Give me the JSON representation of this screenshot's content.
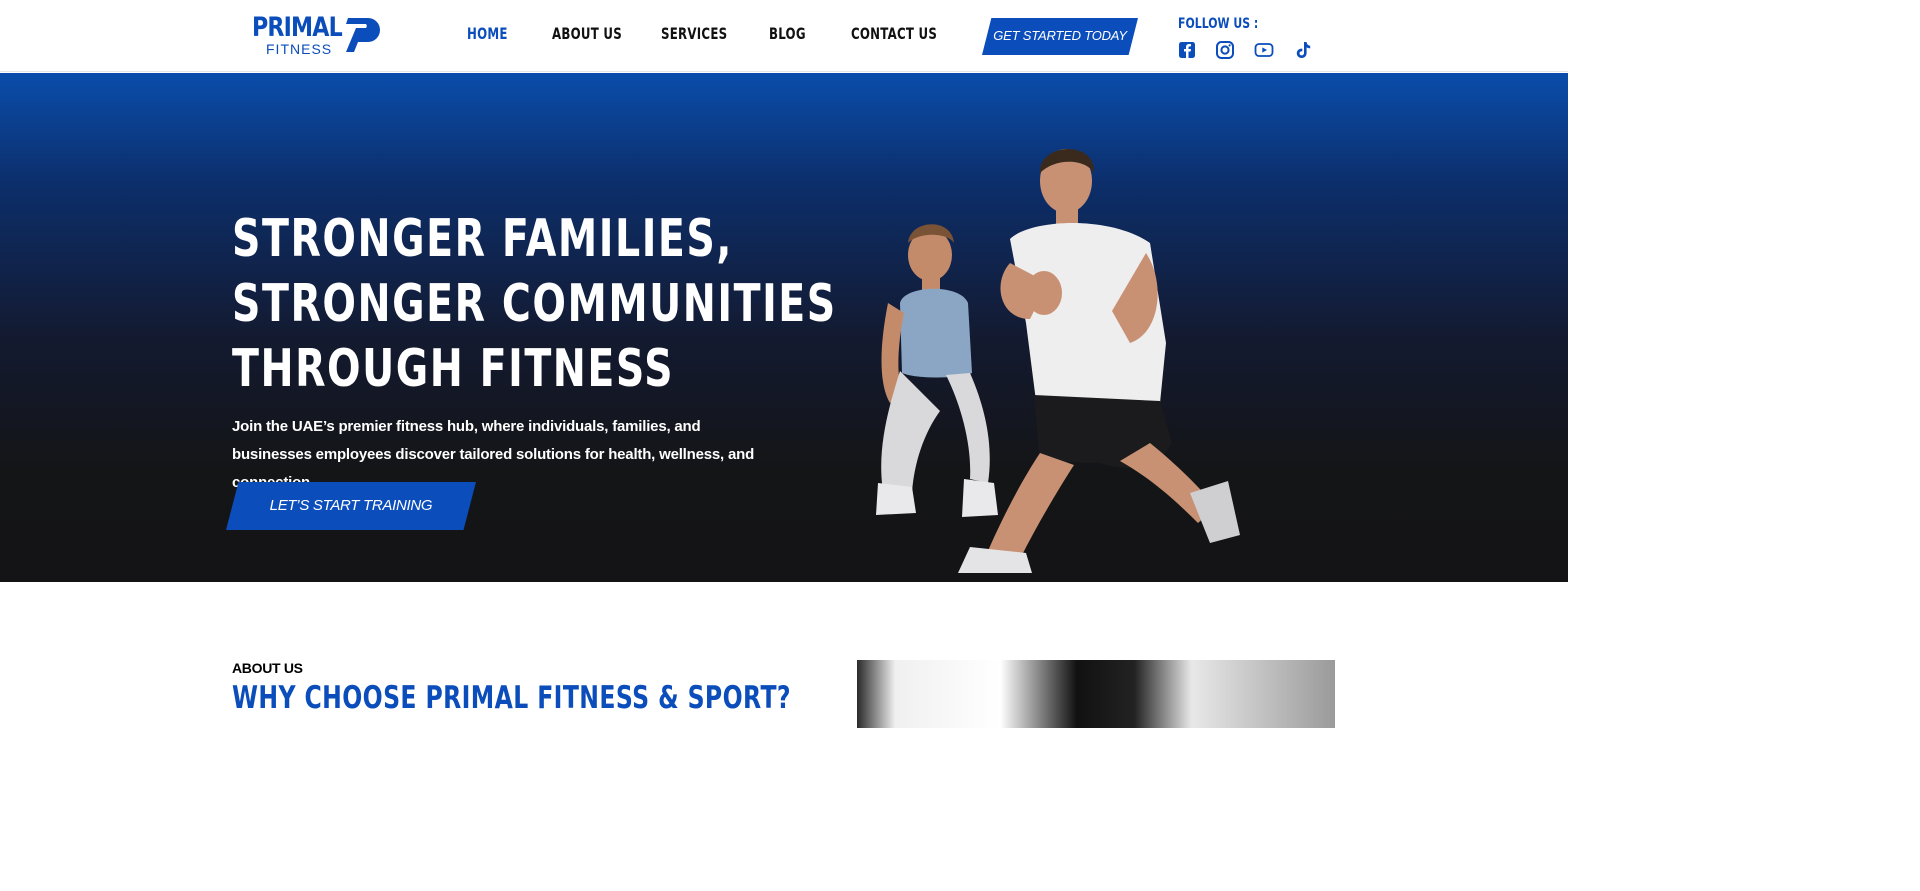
{
  "brand": {
    "logo_primary": "PRIMAL",
    "logo_secondary": "FITNESS",
    "color_primary": "#0a4dbb"
  },
  "nav": {
    "items": [
      {
        "label": "HOME",
        "active": true
      },
      {
        "label": "ABOUT US",
        "active": false
      },
      {
        "label": "SERVICES",
        "active": false
      },
      {
        "label": "BLOG",
        "active": false
      },
      {
        "label": "CONTACT US",
        "active": false
      }
    ],
    "cta_label": "GET STARTED TODAY"
  },
  "social": {
    "label": "FOLLOW US :",
    "icons": [
      "facebook-icon",
      "instagram-icon",
      "youtube-icon",
      "tiktok-icon"
    ]
  },
  "hero": {
    "title_lines": [
      "STRONGER FAMILIES,",
      "STRONGER COMMUNITIES",
      "THROUGH FITNESS"
    ],
    "subtitle": "Join the UAE’s premier fitness hub, where individuals, families, and businesses employees discover tailored solutions for health, wellness, and connection.",
    "cta_label": "LET’S START TRAINING"
  },
  "about": {
    "eyebrow": "ABOUT US",
    "title": "WHY CHOOSE PRIMAL FITNESS & SPORT?"
  }
}
